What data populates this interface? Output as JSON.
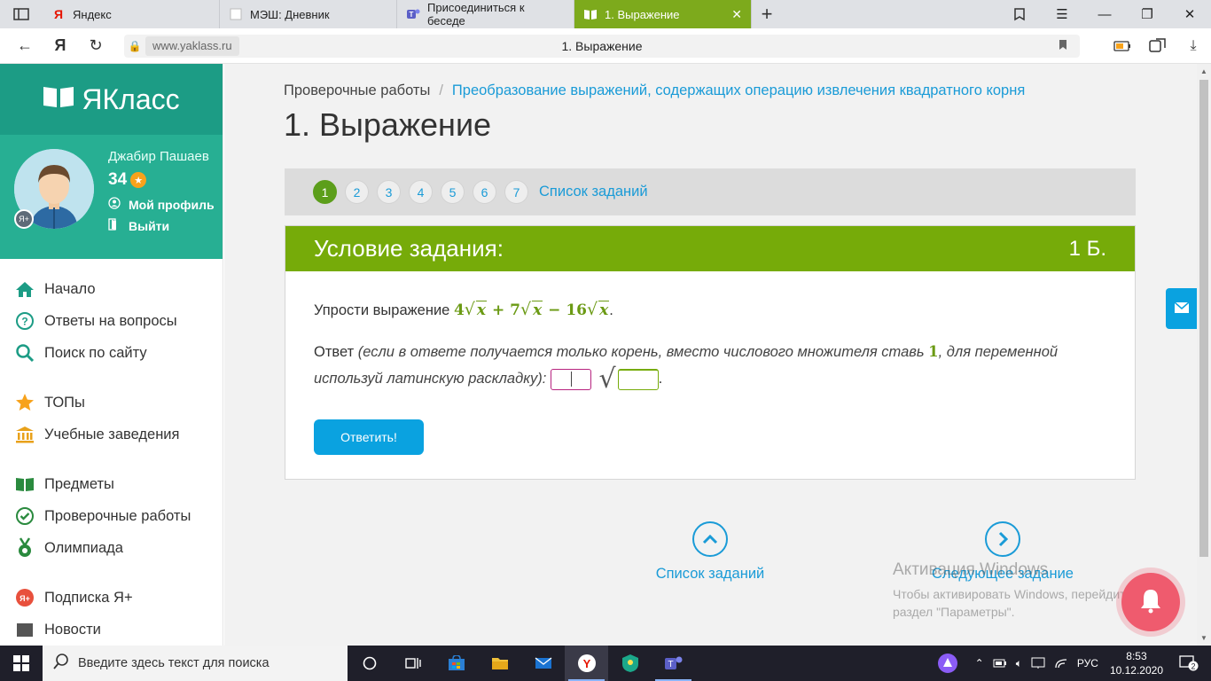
{
  "browser": {
    "tabs": [
      {
        "label": "Яндекс",
        "icon": "yandex-icon",
        "active": false
      },
      {
        "label": "МЭШ: Дневник",
        "icon": "blank-page-icon",
        "active": false
      },
      {
        "label": "Присоединиться к беседе",
        "icon": "teams-icon",
        "active": false
      },
      {
        "label": "1. Выражение",
        "icon": "book-icon",
        "active": true
      }
    ],
    "address": {
      "domain": "www.yaklass.ru",
      "page_title": "1. Выражение"
    }
  },
  "sidebar": {
    "logo_text": "ЯКласс",
    "user": {
      "name": "Джабир Пашаев",
      "points": "34",
      "profile_label": "Мой профиль",
      "logout_label": "Выйти",
      "badge": "Я+"
    },
    "menu": [
      {
        "label": "Начало",
        "icon": "home-icon"
      },
      {
        "label": "Ответы на вопросы",
        "icon": "question-icon"
      },
      {
        "label": "Поиск по сайту",
        "icon": "search-icon"
      },
      {
        "label": "ТОПы",
        "icon": "star-icon"
      },
      {
        "label": "Учебные заведения",
        "icon": "institution-icon"
      },
      {
        "label": "Предметы",
        "icon": "books-icon"
      },
      {
        "label": "Проверочные работы",
        "icon": "check-circle-icon"
      },
      {
        "label": "Олимпиада",
        "icon": "medal-icon"
      },
      {
        "label": "Подписка Я+",
        "icon": "subscription-icon"
      },
      {
        "label": "Новости",
        "icon": "news-icon"
      }
    ]
  },
  "main": {
    "breadcrumb": {
      "root": "Проверочные работы",
      "separator": "/",
      "topic": "Преобразование выражений, содержащих операцию извлечения квадратного корня"
    },
    "title": "1. Выражение",
    "question_nav": {
      "numbers": [
        "1",
        "2",
        "3",
        "4",
        "5",
        "6",
        "7"
      ],
      "current": "1",
      "list_label": "Список заданий"
    },
    "task": {
      "header": "Условие задания:",
      "points": "1 Б.",
      "prompt": "Упрости выражение",
      "expression": {
        "c1": "4",
        "op1": "+",
        "c2": "7",
        "op2": "−",
        "c3": "16",
        "var": "x",
        "end": "."
      },
      "answer_label": "Ответ",
      "answer_hint_1": "(если в ответе получается только корень, вместо числового множителя ставь",
      "answer_hint_num": "1",
      "answer_hint_2": ", для переменной используй латинскую раскладку):",
      "answer_end": ".",
      "submit_label": "Ответить!"
    },
    "bottom_nav": {
      "list_label": "Список заданий",
      "next_label": "Следующее задание"
    },
    "watermark": {
      "line1": "Активация Windows",
      "line2": "Чтобы активировать Windows, перейдите в",
      "line3": "раздел \"Параметры\"."
    }
  },
  "taskbar": {
    "search_placeholder": "Введите здесь текст для поиска",
    "lang": "РУС",
    "time": "8:53",
    "date": "10.12.2020",
    "notifications": "2"
  },
  "colors": {
    "brand_teal": "#1c9c85",
    "task_green": "#76ab09",
    "link_blue": "#1a9bd7",
    "button_blue": "#0aa2e0",
    "active_tab": "#7daa1c"
  }
}
